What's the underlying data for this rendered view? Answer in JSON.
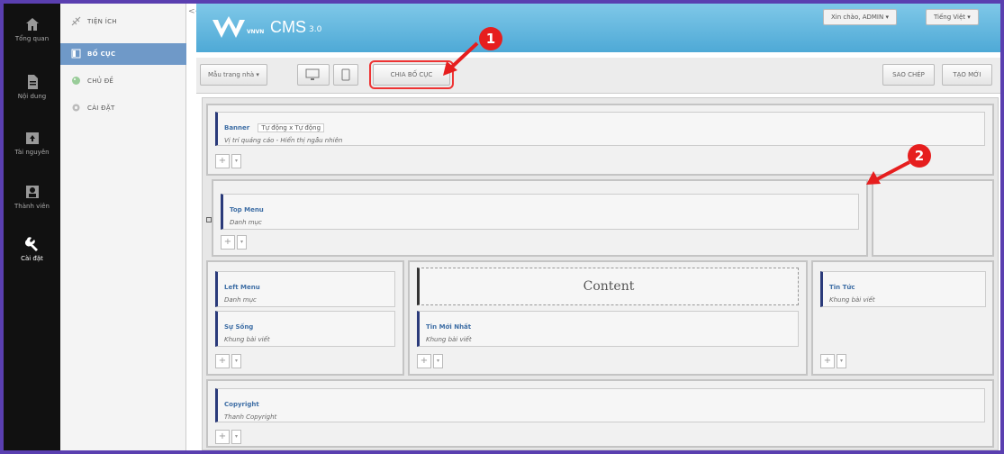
{
  "rail": {
    "items": [
      {
        "label": "Tổng quan",
        "icon": "home-icon"
      },
      {
        "label": "Nội dung",
        "icon": "document-icon"
      },
      {
        "label": "Tài nguyên",
        "icon": "folder-upload-icon"
      },
      {
        "label": "Thành viên",
        "icon": "users-icon"
      },
      {
        "label": "Cài đặt",
        "icon": "wrench-icon"
      }
    ]
  },
  "submenu": {
    "items": [
      {
        "label": "TIỆN ÍCH",
        "icon": "widget-icon"
      },
      {
        "label": "BỐ CỤC",
        "icon": "layout-icon"
      },
      {
        "label": "CHỦ ĐỀ",
        "icon": "palette-icon"
      },
      {
        "label": "CÀI ĐẶT",
        "icon": "gear-icon"
      }
    ],
    "collapse_label": "<<"
  },
  "header": {
    "logo_small": "VNVN",
    "logo_text": "CMS",
    "logo_version": "3.0",
    "greeting": "Xin chào, ADMIN ▾",
    "language": "Tiếng Việt ▾"
  },
  "toolbar": {
    "template_select": "Mẫu trang nhà ▾",
    "split_layout": "CHIA BỐ CỤC",
    "copy": "SAO CHÉP",
    "new": "TẠO MỚI"
  },
  "layout": {
    "banner": {
      "title": "Banner",
      "tag": "Tự động x Tự động",
      "subtitle": "Vị trí quảng cáo - Hiển thị ngẫu nhiên"
    },
    "top_menu": {
      "title": "Top Menu",
      "subtitle": "Danh mục"
    },
    "left_menu": {
      "title": "Left Menu",
      "subtitle": "Danh mục"
    },
    "su_song": {
      "title": "Sự Sống",
      "subtitle": "Khung bài viết"
    },
    "content": {
      "title": "Content"
    },
    "tin_moi_nhat": {
      "title": "Tin Mới Nhất",
      "subtitle": "Khung bài viết"
    },
    "tin_tuc": {
      "title": "Tin Tức",
      "subtitle": "Khung bài viết"
    },
    "copyright": {
      "title": "Copyright",
      "subtitle": "Thanh Copyright"
    },
    "add_symbol": "+",
    "dropdown_symbol": "▾"
  },
  "annotations": {
    "one": "1",
    "two": "2"
  },
  "colors": {
    "accent": "#6f99c8",
    "header": "#4ea9d6",
    "annotation": "#e61e1e"
  }
}
